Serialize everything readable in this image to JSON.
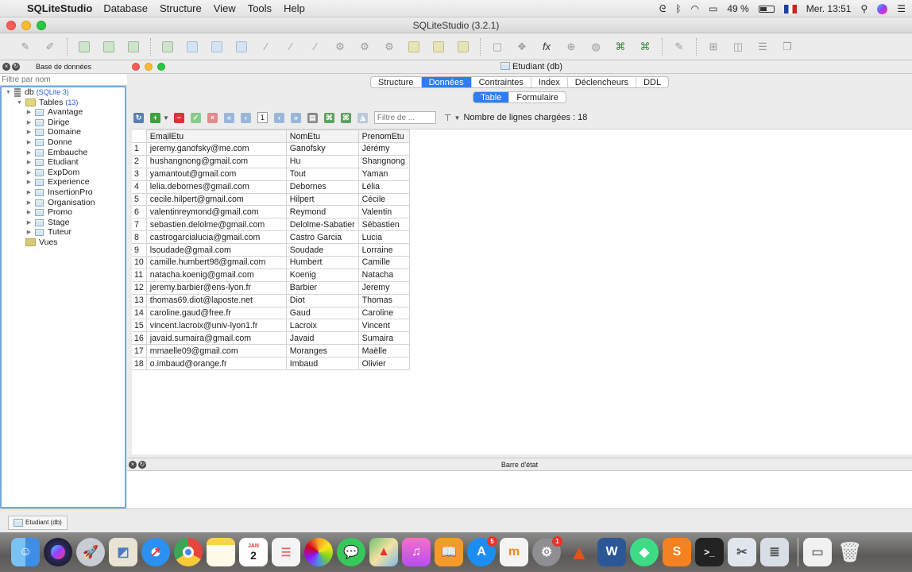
{
  "menubar": {
    "app_name": "SQLiteStudio",
    "items": [
      "Database",
      "Structure",
      "View",
      "Tools",
      "Help"
    ],
    "battery": "49 %",
    "clock": "Mer. 13:51"
  },
  "window": {
    "title": "SQLiteStudio (3.2.1)"
  },
  "db_panel": {
    "title": "Base de données",
    "filter_placeholder": "Filtre par nom",
    "db_name": "db",
    "db_type": "(SQLite 3)",
    "tables_label": "Tables",
    "tables_count": "(13)",
    "tables": [
      "Avantage",
      "Dirige",
      "Domaine",
      "Donne",
      "Embauche",
      "Etudiant",
      "ExpDom",
      "Experience",
      "InsertionPro",
      "Organisation",
      "Promo",
      "Stage",
      "Tuteur"
    ],
    "views_label": "Vues"
  },
  "editor": {
    "title": "Etudiant (db)",
    "tabs": [
      "Structure",
      "Données",
      "Contraintes",
      "Index",
      "Déclencheurs",
      "DDL"
    ],
    "active_tab": "Données",
    "subtabs": [
      "Table",
      "Formulaire"
    ],
    "active_subtab": "Table",
    "page_number": "1",
    "filter_placeholder": "Filtre de ...",
    "row_count": "Nombre de lignes chargées : 18",
    "columns": [
      "EmailEtu",
      "NomEtu",
      "PrenomEtu"
    ],
    "rows": [
      [
        "1",
        "jeremy.ganofsky@me.com",
        "Ganofsky",
        "Jérémy"
      ],
      [
        "2",
        "hushangnong@gmail.com",
        "Hu",
        "Shangnong"
      ],
      [
        "3",
        "yamantout@gmail.com",
        "Tout",
        "Yaman"
      ],
      [
        "4",
        "lelia.debornes@gmail.com",
        "Debornes",
        "Lélia"
      ],
      [
        "5",
        "cecile.hilpert@gmail.com",
        "Hilpert",
        "Cécile"
      ],
      [
        "6",
        "valentinreymond@gmail.com",
        "Reymond",
        "Valentin"
      ],
      [
        "7",
        "sebastien.delolme@gmail.com",
        "Delolme-Sabatier",
        "Sébastien"
      ],
      [
        "8",
        "castrogarcialucia@gmail.com",
        "Castro Garcia",
        "Lucia"
      ],
      [
        "9",
        "lsoudade@gmail.com",
        "Soudade",
        "Lorraine"
      ],
      [
        "10",
        "camille.humbert98@gmail.com",
        "Humbert",
        "Camille"
      ],
      [
        "11",
        "natacha.koenig@gmail.com",
        "Koenig",
        "Natacha"
      ],
      [
        "12",
        "jeremy.barbier@ens-lyon.fr",
        "Barbier",
        "Jeremy"
      ],
      [
        "13",
        "thomas69.diot@laposte.net",
        "Diot",
        "Thomas"
      ],
      [
        "14",
        "caroline.gaud@free.fr",
        "Gaud",
        "Caroline"
      ],
      [
        "15",
        "vincent.lacroix@univ-lyon1.fr",
        "Lacroix",
        "Vincent"
      ],
      [
        "16",
        "javaid.sumaira@gmail.com",
        "Javaid",
        "Sumaira"
      ],
      [
        "17",
        "mmaelle09@gmail.com",
        "Moranges",
        "Maëlle"
      ],
      [
        "18",
        "o.imbaud@orange.fr",
        "Imbaud",
        "Olivier"
      ]
    ]
  },
  "statusbar": {
    "title": "Barre d'état"
  },
  "window_list": {
    "item": "Etudiant (db)"
  },
  "dock": {
    "calendar_day": "2",
    "calendar_month": "JAN",
    "appstore_badge": "5",
    "sysprefs_badge": "1",
    "word_label": "W",
    "sublime_label": "S",
    "terminal_label": ">_",
    "music_label": "♫",
    "finder_label": "☺",
    "colors": {
      "finder": "#3d8ee8",
      "safari": "#2b90f0",
      "chrome": "#e8453c",
      "appstore": "#1c8ef3",
      "word": "#2b5797",
      "sublime": "#f58220",
      "terminal": "#222222"
    }
  },
  "colors": {
    "accent": "#2f7cf6",
    "link_blue": "#2a5bd7",
    "tree_border": "#77a6e0"
  }
}
